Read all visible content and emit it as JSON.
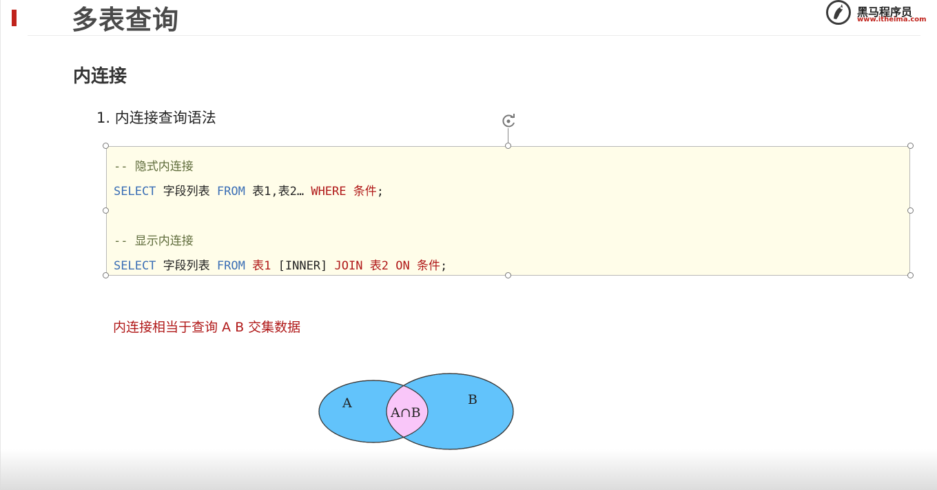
{
  "slide": {
    "title": "多表查询",
    "section_heading": "内连接",
    "list_item": "1. 内连接查询语法",
    "note": "内连接相当于查询 A B 交集数据"
  },
  "logo": {
    "name": "黑马程序员",
    "url": "www.itheima.com"
  },
  "code_block": {
    "comment_implicit": "-- 隐式内连接",
    "line1": {
      "select": "SELECT",
      "fields": "字段列表",
      "from": "FROM",
      "tables": "表1,表2…",
      "where": "WHERE",
      "condition": "条件",
      "end": ";"
    },
    "comment_explicit": "-- 显示内连接",
    "line2": {
      "select": "SELECT",
      "fields": "字段列表",
      "from": "FROM",
      "table1": "表1",
      "inner": "[INNER]",
      "join": "JOIN",
      "table2": "表2",
      "on": "ON",
      "condition": "条件",
      "end": ";"
    }
  },
  "venn": {
    "label_a": "A",
    "label_b": "B",
    "label_intersection": "A∩B",
    "colors": {
      "circles": "#62c3fb",
      "intersection": "#f9c6f9"
    }
  },
  "colors": {
    "accent": "#c0231c",
    "keyword": "#3a6eb5",
    "emphasis": "#b01818",
    "code_bg": "#fffde9"
  }
}
